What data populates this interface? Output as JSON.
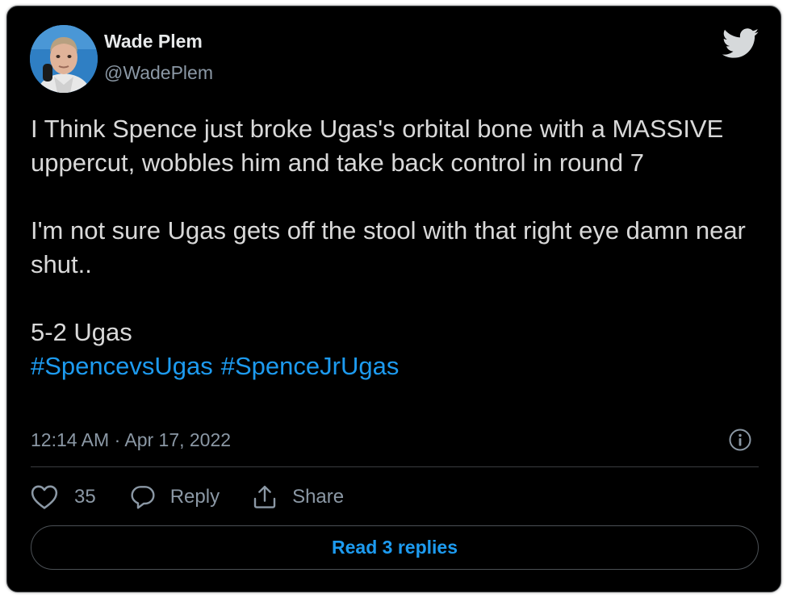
{
  "author": {
    "display_name": "Wade Plem",
    "handle": "@WadePlem",
    "avatar_icon": "profile-photo"
  },
  "brand_icon": "twitter-bird-icon",
  "tweet": {
    "paragraph_1": "I Think Spence just broke Ugas's orbital bone with a MASSIVE uppercut, wobbles him and take back control in round 7",
    "paragraph_2": "I'm not sure Ugas gets off the stool with that right eye damn near shut..",
    "score_line": "5-2 Ugas",
    "hashtags": [
      "#SpencevsUgas",
      "#SpenceJrUgas"
    ],
    "timestamp": "12:14 AM · Apr 17, 2022"
  },
  "actions": {
    "like_count": "35",
    "reply_label": "Reply",
    "share_label": "Share"
  },
  "read_replies_label": "Read 3 replies",
  "colors": {
    "background": "#000000",
    "text": "#d9d9d9",
    "secondary_text": "#8b98a5",
    "accent": "#1d9bf0",
    "border": "#3a3d40"
  }
}
